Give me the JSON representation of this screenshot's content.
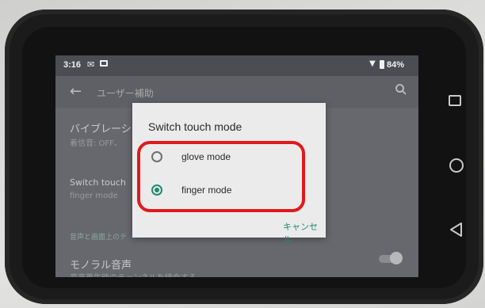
{
  "status_bar": {
    "time": "3:16",
    "notification_icons": [
      "mail-icon",
      "cast-icon"
    ],
    "battery": "84%"
  },
  "toolbar": {
    "title": "ユーザー補助"
  },
  "settings": {
    "vibration_title": "バイブレーシ",
    "vibration_sub": "着信音: OFF、",
    "switch_touch_title": "Switch touch",
    "switch_touch_sub": "finger mode",
    "section_audio": "音声と画面上のテ",
    "mono_audio_title": "モノラル音声",
    "mono_audio_sub": "音声再生時のチャンネルを統合する"
  },
  "dialog": {
    "title": "Switch touch mode",
    "options": [
      {
        "label": "glove mode",
        "selected": false
      },
      {
        "label": "finger mode",
        "selected": true
      }
    ],
    "cancel_label": "キャンセル"
  },
  "colors": {
    "accent": "#1f8a70",
    "highlight": "#e01a1a"
  },
  "nav_buttons": [
    "recents-icon",
    "home-icon",
    "back-icon"
  ]
}
